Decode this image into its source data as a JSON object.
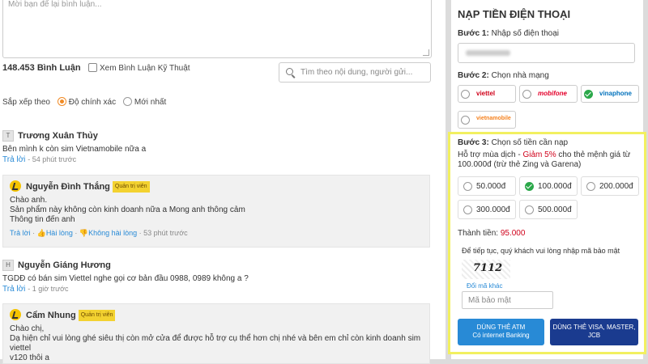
{
  "comment_box": {
    "placeholder": "Mời bạn để lại bình luận..."
  },
  "toolbar": {
    "count": "148.453 Bình Luận",
    "tech_label": "Xem Bình Luận Kỹ Thuật",
    "search_placeholder": "Tìm theo nội dung, người gửi..."
  },
  "sort": {
    "label": "Sắp xếp theo",
    "options": [
      "Độ chính xác",
      "Mới nhất"
    ],
    "selected": "Độ chính xác"
  },
  "comments": [
    {
      "avatar": "T",
      "name": "Trương Xuân Thủy",
      "text": "Bên mình k còn sim Vietnamobile nữa a",
      "reply": "Trả lời",
      "time": "54 phút trước",
      "admin": {
        "name": "Nguyễn Đình Thắng",
        "badge": "Quản trị viên",
        "lines": [
          "Chào anh.",
          "Sản phẩm này không còn kinh doanh nữa a Mong anh thông cảm",
          "Thông tin đến anh"
        ],
        "reply": "Trả lời",
        "like": "Hài lòng",
        "dislike": "Không hài lòng",
        "time": "53 phút trước"
      }
    },
    {
      "avatar": "H",
      "name": "Nguyễn Giáng Hương",
      "text": "TGDĐ có bán sim Viettel nghe gọi cơ bản đầu 0988, 0989 không a ?",
      "reply": "Trả lời",
      "time": "1 giờ trước",
      "admin": {
        "name": "Cẩm Nhung",
        "badge": "Quản trị viên",
        "lines": [
          "Chào chị,",
          "Dạ hiện chỉ vui lòng ghé siêu thị còn mở cửa để được hỗ trợ cụ thể hơn chị nhé và bên em chỉ còn kinh doanh sim viettel",
          "v120 thôi a"
        ]
      }
    }
  ],
  "topup": {
    "title": "NẠP TIỀN ĐIỆN THOẠI",
    "step1_label": "Bước 1:",
    "step1_text": "Nhập số điện thoại",
    "step2_label": "Bước 2:",
    "step2_text": "Chọn nhà mạng",
    "networks": [
      "viettel",
      "mobifone",
      "vinaphone",
      "vietnamobile"
    ],
    "network_selected": "vinaphone",
    "step3_label": "Bước 3:",
    "step3_text": "Chọn số tiền cần nạp",
    "promo_pre": "Hỗ trợ mùa dịch - ",
    "promo_red": "Giảm 5%",
    "promo_post": " cho thẻ mệnh giá từ 100.000đ (trừ thẻ Zing và Garena)",
    "amounts": [
      "50.000đ",
      "100.000đ",
      "200.000đ",
      "300.000đ",
      "500.000đ"
    ],
    "amount_selected": "100.000đ",
    "total_label": "Thành tiền:",
    "total_value": "95.000",
    "captcha_note": "Để tiếp tục, quý khách vui lòng nhập mã bảo mật",
    "captcha": "7112",
    "change_captcha": "Đổi mã khác",
    "captcha_placeholder": "Mã bảo mật",
    "btn_atm_1": "DÙNG THẺ ATM",
    "btn_atm_2": "Có internet Banking",
    "btn_visa_1": "DÙNG THẺ VISA, MASTER,",
    "btn_visa_2": "JCB"
  },
  "colors": {
    "accent_blue": "#288ad6",
    "orange": "#f08a24",
    "highlight": "#f2f060",
    "atm_btn": "#288ad6",
    "visa_btn": "#1a3b8f",
    "red": "#d0021b"
  }
}
